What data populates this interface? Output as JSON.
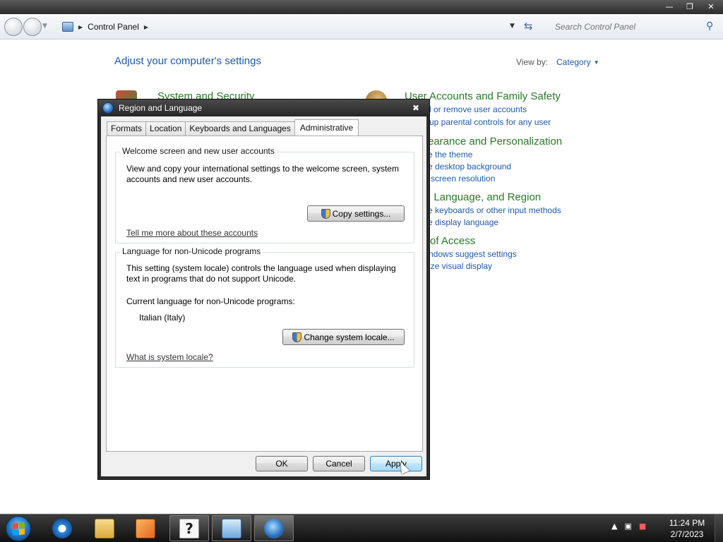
{
  "control_panel": {
    "address": {
      "breadcrumb": "Control Panel"
    },
    "search": {
      "placeholder": "Search Control Panel"
    },
    "heading": "Adjust your computer's settings",
    "view_by_label": "View by:",
    "view_by_value": "Category",
    "categories": [
      {
        "title": "System and Security",
        "icon": "shield-icon",
        "links": []
      },
      {
        "title": "User Accounts and Family Safety",
        "icon": "users-icon",
        "links": [
          "Add or remove user accounts",
          "Set up parental controls for any user"
        ]
      },
      {
        "title": "Appearance and Personalization",
        "icon": "appearance-icon",
        "links": [
          "Change the theme",
          "Change desktop background",
          "Adjust screen resolution"
        ]
      },
      {
        "title": "Clock, Language, and Region",
        "icon": "clock-icon",
        "links": [
          "Change keyboards or other input methods",
          "Change display language"
        ]
      },
      {
        "title": "Ease of Access",
        "icon": "ease-of-access-icon",
        "links": [
          "Let Windows suggest settings",
          "Optimize visual display"
        ]
      }
    ]
  },
  "visible_category_text": {
    "c0_title": "System and Security",
    "c1_title": "User Accounts and Family Safety",
    "c1_l0": "d or remove user accounts",
    "c1_l1": "up parental controls for any user",
    "c2_title": "earance and Personalization",
    "c2_l0": "e the theme",
    "c2_l1": "e desktop background",
    "c2_l2": "screen resolution",
    "c3_title": ", Language, and Region",
    "c3_l0": "e keyboards or other input methods",
    "c3_l1": "e display language",
    "c4_title": "of Access",
    "c4_l0": "ndows suggest settings",
    "c4_l1": "ize visual display"
  },
  "dialog": {
    "title": "Region and Language",
    "tabs": [
      "Formats",
      "Location",
      "Keyboards and Languages",
      "Administrative"
    ],
    "active_tab": "Administrative",
    "welcome_group": {
      "legend": "Welcome screen and new user accounts",
      "description_line1": "View and copy your international settings to the welcome screen, system",
      "description_line2": "accounts and new user accounts.",
      "button": "Copy settings...",
      "link": "Tell me more about these accounts"
    },
    "unicode_group": {
      "legend": "Language for non-Unicode programs",
      "description_line1": "This setting (system locale) controls the language used when displaying",
      "description_line2": "text in programs that do not support Unicode.",
      "current_label": "Current language for non-Unicode programs:",
      "current_value": "Italian (Italy)",
      "button": "Change system locale...",
      "link": "What is system locale?"
    },
    "buttons": {
      "ok": "OK",
      "cancel": "Cancel",
      "apply": "Apply"
    }
  },
  "taskbar": {
    "items": [
      "start-button",
      "internet-explorer-icon",
      "windows-explorer-icon",
      "media-player-icon",
      "help-icon",
      "control-panel-icon",
      "region-language-icon"
    ],
    "clock": {
      "time": "11:24 PM",
      "date": "2/7/2023"
    }
  },
  "colors": {
    "link_blue": "#1e5aa8",
    "category_green": "#267a26"
  }
}
